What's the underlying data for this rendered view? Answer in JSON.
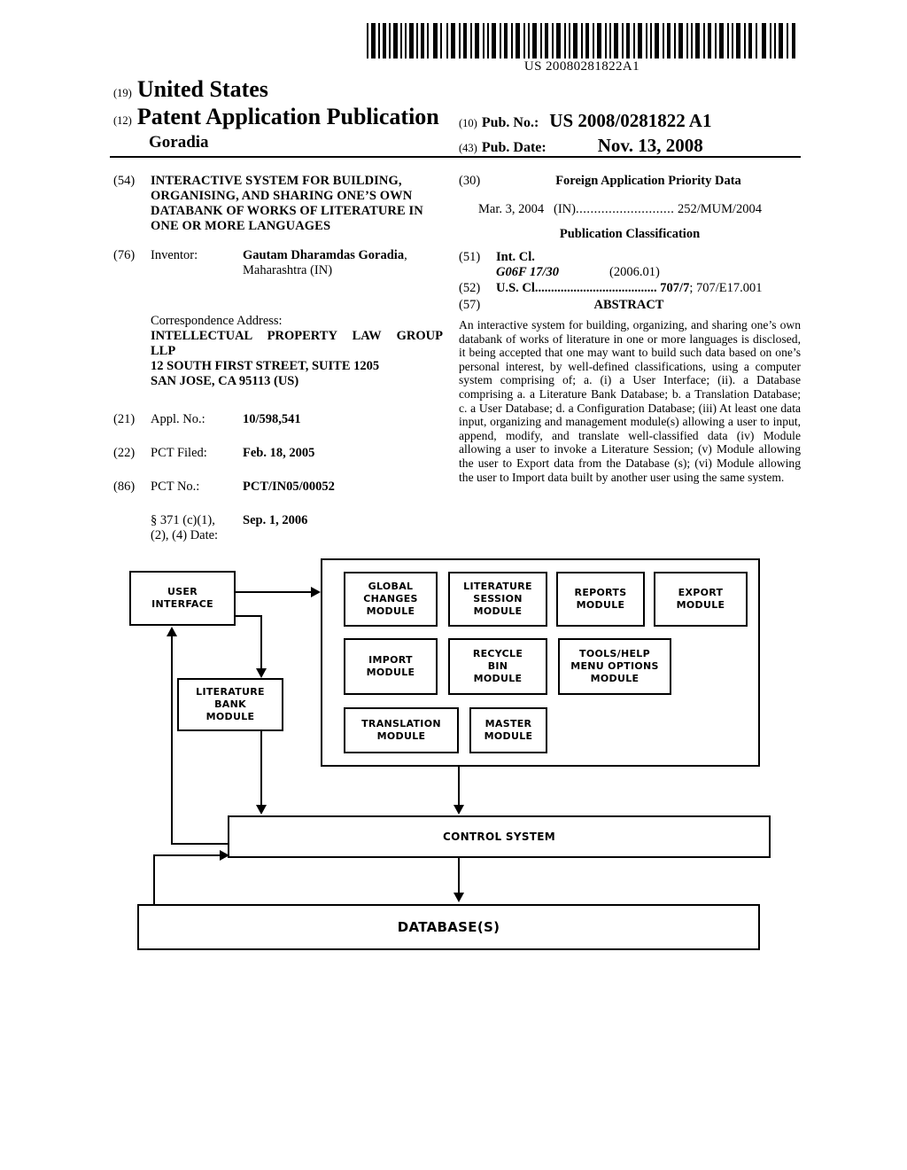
{
  "barcode": {
    "number": "US 20080281822A1",
    "icon": "barcode-icon"
  },
  "masthead": {
    "country_num": "(19)",
    "country": "United States",
    "doc_type_num": "(12)",
    "doc_type": "Patent Application Publication",
    "author": "Goradia",
    "pubno_num": "(10)",
    "pubno_label": "Pub. No.:",
    "pubno_value": "US 2008/0281822 A1",
    "pubdate_num": "(43)",
    "pubdate_label": "Pub. Date:",
    "pubdate_value": "Nov. 13, 2008"
  },
  "left_column": {
    "title_num": "(54)",
    "title": "INTERACTIVE SYSTEM FOR BUILDING, ORGANISING, AND SHARING ONE’S OWN DATABANK OF WORKS OF LITERATURE IN ONE OR MORE LANGUAGES",
    "inventor_num": "(76)",
    "inventor_label": "Inventor:",
    "inventor_name": "Gautam Dharamdas Goradia",
    "inventor_name_suffix": ",",
    "inventor_location": "Maharashtra (IN)",
    "correspondence_lead": "Correspondence Address:",
    "correspondence_firm": "INTELLECTUAL PROPERTY LAW GROUP",
    "correspondence_firm2": "LLP",
    "correspondence_street": "12 SOUTH FIRST STREET, SUITE 1205",
    "correspondence_city": "SAN JOSE, CA 95113 (US)",
    "appl_num": "(21)",
    "appl_label": "Appl. No.:",
    "appl_value": "10/598,541",
    "pctfiled_num": "(22)",
    "pctfiled_label": "PCT Filed:",
    "pctfiled_value": "Feb. 18, 2005",
    "pctno_num": "(86)",
    "pctno_label": "PCT No.:",
    "pctno_value": "PCT/IN05/00052",
    "s371_line1": "§ 371 (c)(1),",
    "s371_line2": "(2), (4) Date:",
    "s371_value": "Sep. 1, 2006"
  },
  "right_column": {
    "foreign_num": "(30)",
    "foreign_heading": "Foreign Application Priority Data",
    "priority_date": "Mar. 3, 2004",
    "priority_country": "(IN)",
    "priority_dots": "...........................",
    "priority_value": "252/MUM/2004",
    "pubclass_heading": "Publication Classification",
    "intcl_num": "(51)",
    "intcl_label": "Int. Cl.",
    "intcl_code": "G06F  17/30",
    "intcl_version": "(2006.01)",
    "uscl_num": "(52)",
    "uscl_label": "U.S. Cl.",
    "uscl_dots": ".....................................",
    "uscl_value_bold": "707/7",
    "uscl_value_rest": "; 707/E17.001",
    "abstract_num": "(57)",
    "abstract_heading": "ABSTRACT",
    "abstract_text": "An interactive system for building, organizing, and sharing one’s own databank of works of literature in one or more languages is disclosed, it being accepted that one may want to build such data based on one’s personal interest, by well-defined classifications, using a computer system comprising of; a. (i) a User Interface; (ii). a Database comprising a. a Literature Bank Database; b. a Translation Database; c. a User Database; d. a Configuration Database; (iii) At least one data input, organizing and management module(s) allowing a user to input, append, modify, and translate well-classified data (iv) Module allowing a user to invoke a Literature Session; (v) Module allowing the user to Export data from the Database (s); (vi) Module allowing the user to Import data built by another user using the same system."
  },
  "diagram": {
    "user_interface": "USER\nINTERFACE",
    "literature_bank": "LITERATURE\nBANK\nMODULE",
    "modules": [
      {
        "id": "global-changes-module",
        "label": "GLOBAL\nCHANGES\nMODULE"
      },
      {
        "id": "literature-session-module",
        "label": "LITERATURE\nSESSION\nMODULE"
      },
      {
        "id": "reports-module",
        "label": "REPORTS\nMODULE"
      },
      {
        "id": "export-module",
        "label": "EXPORT\nMODULE"
      },
      {
        "id": "import-module",
        "label": "IMPORT\nMODULE"
      },
      {
        "id": "recycle-bin-module",
        "label": "RECYCLE\nBIN\nMODULE"
      },
      {
        "id": "tools-help-menu-options-module",
        "label": "TOOLS/HELP\nMENU OPTIONS\nMODULE"
      },
      {
        "id": "translation-module",
        "label": "TRANSLATION\nMODULE"
      },
      {
        "id": "master-module",
        "label": "MASTER\nMODULE"
      }
    ],
    "control_system": "CONTROL SYSTEM",
    "databases": "DATABASE(S)"
  }
}
